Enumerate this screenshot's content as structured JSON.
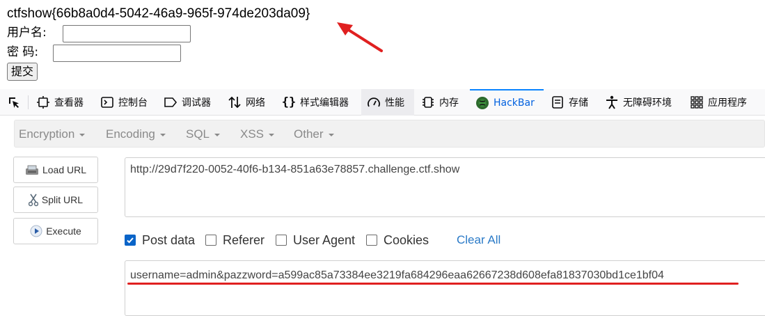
{
  "page": {
    "flag_text": "ctfshow{66b8a0d4-5042-46a9-965f-974de203da09}",
    "username_label": "用户名:",
    "password_label": "密 码:",
    "username_value": "",
    "password_value": "",
    "submit_label": "提交"
  },
  "devtools": {
    "tabs": [
      {
        "label": "查看器",
        "icon": "inspector-icon"
      },
      {
        "label": "控制台",
        "icon": "console-icon"
      },
      {
        "label": "调试器",
        "icon": "debugger-icon"
      },
      {
        "label": "网络",
        "icon": "network-icon"
      },
      {
        "label": "样式编辑器",
        "icon": "style-editor-icon"
      },
      {
        "label": "性能",
        "icon": "performance-icon"
      },
      {
        "label": "内存",
        "icon": "memory-icon"
      },
      {
        "label": "HackBar",
        "icon": "hackbar-icon"
      },
      {
        "label": "存储",
        "icon": "storage-icon"
      },
      {
        "label": "无障碍环境",
        "icon": "accessibility-icon"
      },
      {
        "label": "应用程序",
        "icon": "application-icon"
      }
    ],
    "selected_tab": "HackBar"
  },
  "hackbar": {
    "menus": [
      "Encryption",
      "Encoding",
      "SQL",
      "XSS",
      "Other"
    ],
    "buttons": {
      "load_url": "Load URL",
      "split_url": "Split URL",
      "execute": "Execute"
    },
    "url": "http://29d7f220-0052-40f6-b134-851a63e78857.challenge.ctf.show",
    "options": {
      "post_data": {
        "label": "Post data",
        "checked": true
      },
      "referer": {
        "label": "Referer",
        "checked": false
      },
      "user_agent": {
        "label": "User Agent",
        "checked": false
      },
      "cookies": {
        "label": "Cookies",
        "checked": false
      }
    },
    "clear_all": "Clear All",
    "post_body": "username=admin&pazzword=a599ac85a73384ee3219fa684296eaa62667238d608efa81837030bd1ce1bf04"
  },
  "colors": {
    "annotation_red": "#e02020",
    "hackbar_accent": "#0a84ff",
    "checkbox_blue": "#0a64c8",
    "link_blue": "#2a7ac7"
  }
}
